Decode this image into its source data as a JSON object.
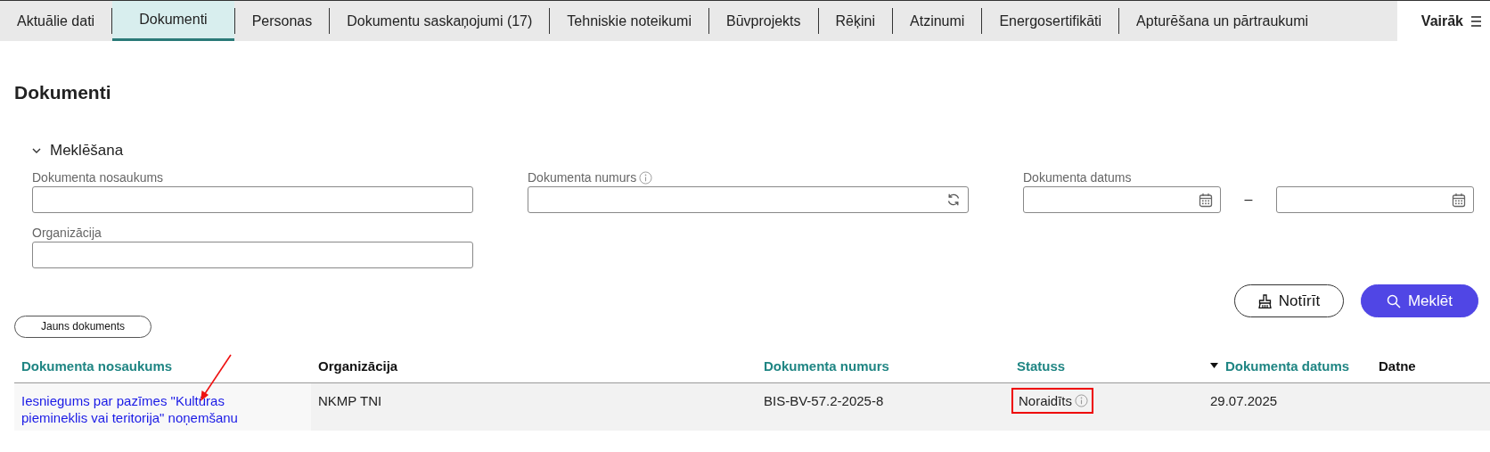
{
  "tabs": [
    {
      "label": "Aktuālie dati",
      "selected": false
    },
    {
      "label": "Dokumenti",
      "selected": true
    },
    {
      "label": "Personas",
      "selected": false
    },
    {
      "label": "Dokumentu saskaņojumi (17)",
      "selected": false
    },
    {
      "label": "Tehniskie noteikumi",
      "selected": false
    },
    {
      "label": "Būvprojekts",
      "selected": false
    },
    {
      "label": "Rēķini",
      "selected": false
    },
    {
      "label": "Atzinumi",
      "selected": false
    },
    {
      "label": "Energosertifikāti",
      "selected": false
    },
    {
      "label": "Apturēšana un pārtraukumi",
      "selected": false
    }
  ],
  "more_tab": {
    "label": "Vairāk"
  },
  "page_title": "Dokumenti",
  "search": {
    "title": "Meklēšana",
    "expanded": true,
    "fields": [
      {
        "label": "Dokumenta nosaukums",
        "kind": "text"
      },
      {
        "label": "Dokumenta numurs",
        "kind": "refresh"
      },
      {
        "label": "Dokumenta datums",
        "kind": "daterange",
        "separator": "–"
      },
      {
        "label": "Organizācija",
        "kind": "text"
      }
    ],
    "buttons": [
      {
        "label": "Notīrīt",
        "kind": "clear"
      },
      {
        "label": "Meklēt",
        "kind": "search"
      }
    ]
  },
  "new_button": "Jauns dokuments",
  "table": {
    "columns": [
      {
        "label": "Dokumenta nosaukums",
        "sortable": true,
        "sorted": false
      },
      {
        "label": "Organizācija",
        "sortable": false,
        "sorted": false
      },
      {
        "label": "Dokumenta numurs",
        "sortable": true,
        "sorted": false
      },
      {
        "label": "Statuss",
        "sortable": true,
        "sorted": false
      },
      {
        "label": "Dokumenta datums",
        "sortable": true,
        "sorted": true
      },
      {
        "label": "Datne",
        "sortable": false,
        "sorted": false
      }
    ],
    "rows": [
      {
        "name": "Iesniegums par pazīmes \"Kultūras piemineklis vai teritorija\" noņemšanu",
        "name_pointed": true,
        "organization": "NKMP TNI",
        "number": "BIS-BV-57.2-2025-8",
        "status": "Noraidīts",
        "status_highlighted": true,
        "date": "29.07.2025"
      }
    ]
  }
}
